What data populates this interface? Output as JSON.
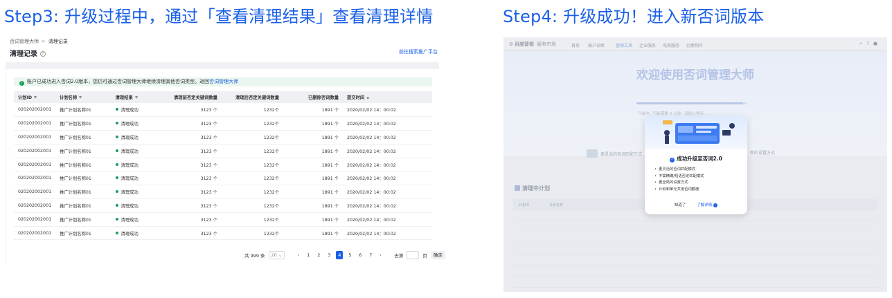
{
  "steps": {
    "step3_title": "Step3: 升级过程中，通过「查看清理结果」查看清理详情",
    "step4_title": "Step4: 升级成功！进入新否词版本"
  },
  "left": {
    "breadcrumb": [
      "否词管理大师",
      "清理记录"
    ],
    "page_title": "清理记录",
    "go_link": "前往搜索推广平台",
    "notice_text": "账户已成功进入否词2.0版本，您仍可通过否词管理大师继续清理其他否词类型。返回",
    "notice_link": "否词管理大师",
    "columns": [
      "计划ID",
      "计划名称",
      "清理结果",
      "清理前否定关键词数量",
      "清理后否定关键词数量",
      "已删除否词数量",
      "提交时间"
    ],
    "rows": [
      [
        "020202002001",
        "推广计划名称01",
        "清理成功",
        "3123 个",
        "1232个",
        "1891 个",
        "2020/02/02 14：00:02"
      ],
      [
        "020202002001",
        "推广计划名称01",
        "清理成功",
        "3123 个",
        "1232个",
        "1891 个",
        "2020/02/02 14：00:02"
      ],
      [
        "020202002001",
        "推广计划名称01",
        "清理成功",
        "3123 个",
        "1232个",
        "1891 个",
        "2020/02/02 14：00:02"
      ],
      [
        "020202002001",
        "推广计划名称01",
        "清理成功",
        "3123 个",
        "1232个",
        "1891 个",
        "2020/02/02 14：00:02"
      ],
      [
        "020202002001",
        "推广计划名称01",
        "清理成功",
        "3123 个",
        "1232个",
        "1891 个",
        "2020/02/02 14：00:02"
      ],
      [
        "020202002001",
        "推广计划名称01",
        "清理成功",
        "3123 个",
        "1232个",
        "1891 个",
        "2020/02/02 14：00:02"
      ],
      [
        "020202002001",
        "推广计划名称01",
        "清理成功",
        "3123 个",
        "1232个",
        "1891 个",
        "2020/02/02 14：00:02"
      ],
      [
        "020202002001",
        "推广计划名称01",
        "清理成功",
        "3123 个",
        "1232个",
        "1891 个",
        "2020/02/02 14：00:02"
      ],
      [
        "020202002001",
        "推广计划名称01",
        "清理成功",
        "3123 个",
        "1232个",
        "1891 个",
        "2020/02/02 14：00:02"
      ],
      [
        "020202002001",
        "推广计划名称01",
        "清理成功",
        "3123 个",
        "1232个",
        "1891 个",
        "2020/02/02 14：00:02"
      ]
    ],
    "pager": {
      "total": "共 999 条",
      "page_size": "20",
      "pages": [
        "1",
        "2",
        "3",
        "4",
        "5",
        "6",
        "7"
      ],
      "active_page": "4",
      "goto_label": "去第",
      "page_unit": "页",
      "confirm": "确定"
    },
    "colors": {
      "accent": "#1a5fe6",
      "success": "#18a058"
    }
  },
  "right": {
    "logo": "百度营销",
    "logo_sub": "服务市场",
    "nav": [
      "首页",
      "账户诊断",
      "营销工具",
      "企业服务",
      "电商服务",
      "创意制作"
    ],
    "active_nav": "营销工具",
    "welcome": "欢迎使用否词管理大师",
    "loading": "升级中，可能需要 3 分钟，请耐心等待……",
    "feature_left": "更灵活的否词匹配方式",
    "feature_right": "新的设置方式",
    "plan_title": "清理中计划",
    "table_head": [
      "计划ID",
      "计划名称"
    ],
    "modal": {
      "title": "成功升级至否词2.0",
      "items": [
        "更灵活的否词匹配模式",
        "不需精确/短语否定匹配模式",
        "更全局的设置方式",
        "计划和单元共用否词额度"
      ],
      "ok": "知道了",
      "more": "了解详情"
    }
  }
}
